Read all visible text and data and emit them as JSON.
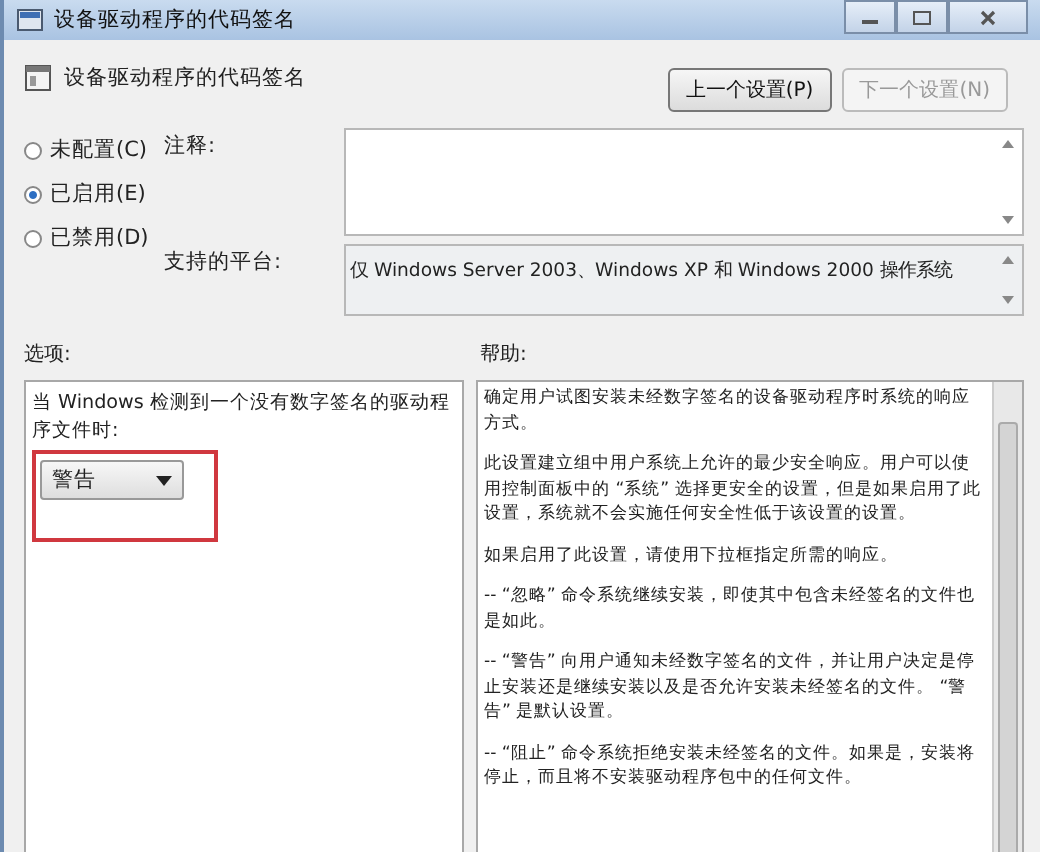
{
  "window": {
    "title": "设备驱动程序的代码签名"
  },
  "header": {
    "title": "设备驱动程序的代码签名",
    "buttons": [
      {
        "label": "上一个设置(P)",
        "disabled": false
      },
      {
        "label": "下一个设置(N)",
        "disabled": true
      }
    ]
  },
  "states": [
    {
      "label": "未配置(C)",
      "selected": false
    },
    {
      "label": "已启用(E)",
      "selected": true
    },
    {
      "label": "已禁用(D)",
      "selected": false
    }
  ],
  "comment": {
    "label": "注释:"
  },
  "platform": {
    "label": "支持的平台:",
    "value": "仅 Windows Server 2003、Windows XP 和 Windows 2000 操作系统"
  },
  "options": {
    "label": "选项:",
    "prompt": "当 Windows 检测到一个没有数字签名的驱动程序文件时:",
    "dropdown": "警告"
  },
  "help": {
    "label": "帮助:",
    "paragraphs": [
      "确定用户试图安装未经数字签名的设备驱动程序时系统的响应方式。",
      "此设置建立组中用户系统上允许的最少安全响应。用户可以使用控制面板中的 “系统” 选择更安全的设置，但是如果启用了此设置，系统就不会实施任何安全性低于该设置的设置。",
      "如果启用了此设置，请使用下拉框指定所需的响应。",
      "-- “忽略” 命令系统继续安装，即使其中包含未经签名的文件也是如此。",
      "-- “警告” 向用户通知未经数字签名的文件，并让用户决定是停止安装还是继续安装以及是否允许安装未经签名的文件。 “警告” 是默认设置。",
      "-- “阻止” 命令系统拒绝安装未经签名的文件。如果是，安装将停止，而且将不安装驱动程序包中的任何文件。"
    ]
  }
}
